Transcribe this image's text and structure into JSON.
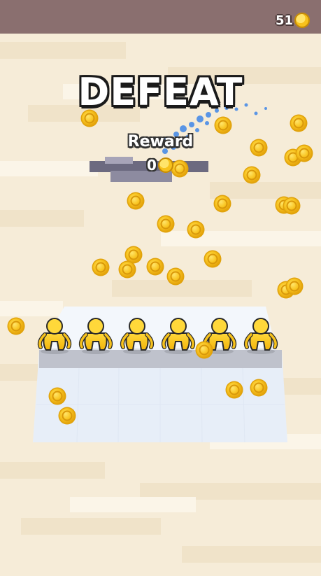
{
  "hud": {
    "coins": "51",
    "coin_icon": "coin-icon"
  },
  "result": {
    "title": "DEFEAT",
    "reward_label": "Reward",
    "reward_value": "0",
    "reward_icon": "coin-icon"
  },
  "colors": {
    "floor": "#f6ecd8",
    "top_bar": "#8a6f6f",
    "coin": "#f7c21c",
    "character": "#f5c518",
    "platform": "#e7eef8"
  },
  "characters": {
    "count": 6,
    "name": "yellow-runner"
  }
}
